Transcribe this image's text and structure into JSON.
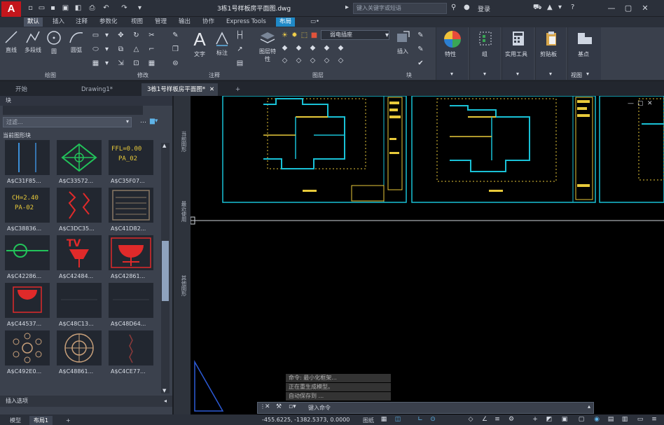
{
  "app": {
    "logo_text": "A",
    "doc_title": "3栋1号样板房平面图.dwg",
    "search_placeholder": "键入关键字或短语",
    "login_label": "登录"
  },
  "ribbon_tabs": [
    "默认",
    "插入",
    "注释",
    "参数化",
    "视图",
    "管理",
    "输出",
    "协作",
    "Express Tools",
    "布局"
  ],
  "ribbon": {
    "draw": {
      "line": "直线",
      "polyline": "多段线",
      "circle": "圆",
      "arc": "圆弧",
      "label": "绘图"
    },
    "modify": {
      "label": "修改"
    },
    "annotation": {
      "text": "文字",
      "dimension": "标注",
      "label": "注释"
    },
    "layers": {
      "layer_props": "图层特性",
      "current_layer": "弱电插座",
      "label": "图层"
    },
    "block": {
      "insert": "插入",
      "label": "块"
    },
    "properties": "特性",
    "groups": "组",
    "utilities": "实用工具",
    "clipboard": "剪贴板",
    "base": "基点",
    "view": "视图"
  },
  "file_tabs": [
    "开始",
    "Drawing1*",
    "3栋1号样板房平面图*"
  ],
  "palette": {
    "header": "块",
    "filter_placeholder": "过滤...",
    "section": "当前图形块",
    "items": [
      "A$C31F85...",
      "A$C33572...",
      "A$C35F07...",
      "A$C38836...",
      "A$C3DC35...",
      "A$C41D82...",
      "A$C42286...",
      "A$C42484...",
      "A$C42861...",
      "A$C44537...",
      "A$C48C13...",
      "A$C48D64...",
      "A$C492E0...",
      "A$C48861...",
      "A$C4CE77..."
    ],
    "thumb_texts": {
      "ffl": "FFL=0.00",
      "pa02": "PA_02",
      "ch": "CH=2.40",
      "pa02b": "PA-02"
    },
    "insert_options": "插入选项",
    "side_tabs": [
      "当前图形",
      "最近使用",
      "其他图形"
    ]
  },
  "command": {
    "history": [
      "命令: 最小化框架...",
      "正在重生成模型。",
      "自动保存到 ..."
    ],
    "prompt": "键入命令"
  },
  "statusbar": {
    "model_tab": "模型",
    "layout_tab": "布局1",
    "coords": "-455.6225, -1382.5373, 0.0000",
    "paper": "图纸"
  }
}
